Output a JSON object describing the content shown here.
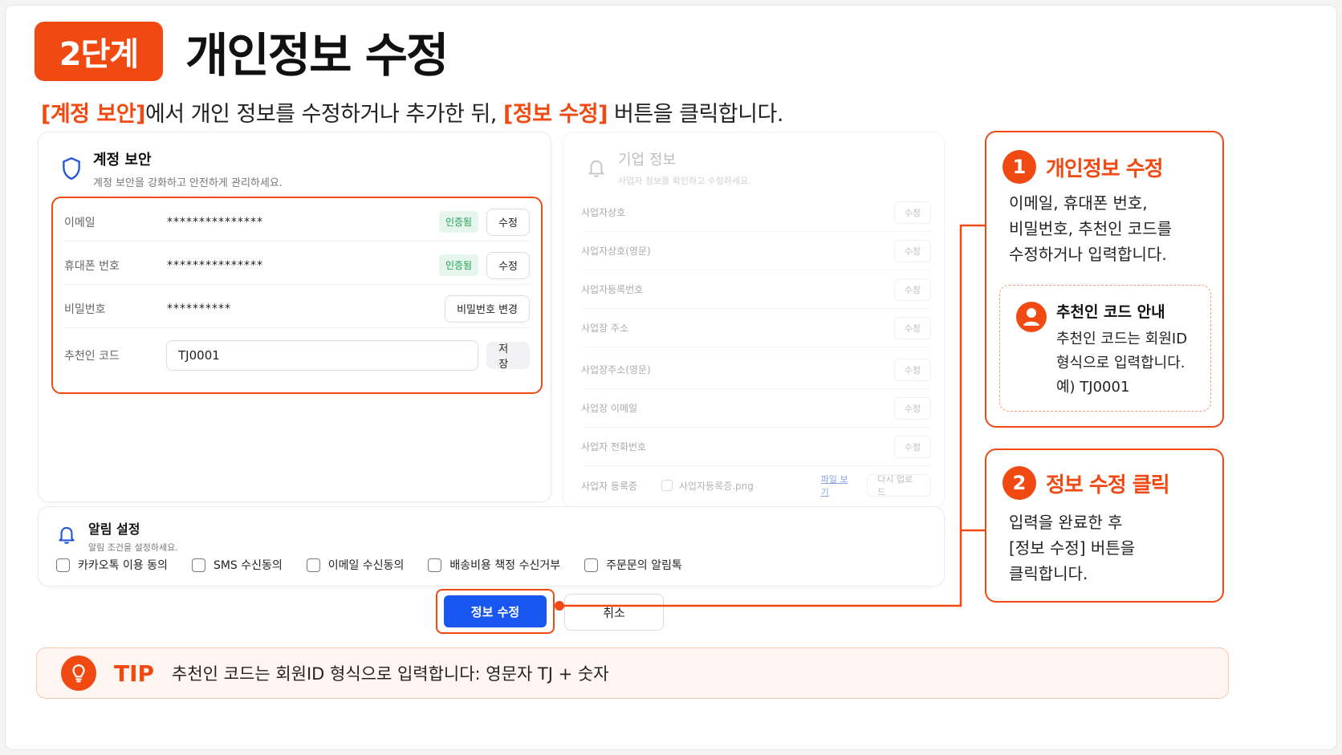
{
  "header": {
    "step_badge": "2단계",
    "title": "개인정보 수정",
    "subtitle": {
      "part1": "[계정 보안]",
      "part2": "에서 개인 정보를 수정하거나 추가한 뒤, ",
      "part3": "[정보 수정]",
      "part4": " 버튼을 클릭합니다."
    }
  },
  "security_card": {
    "title": "계정 보안",
    "desc": "계정 보안을 강화하고 안전하게 관리하세요.",
    "rows": [
      {
        "label": "이메일",
        "value": "***************",
        "badge": "인증됨",
        "button": "수정"
      },
      {
        "label": "휴대폰 번호",
        "value": "***************",
        "badge": "인증됨",
        "button": "수정"
      },
      {
        "label": "비밀번호",
        "value": "**********",
        "button": "비밀번호 변경"
      },
      {
        "label": "추천인 코드",
        "value": "TJ0001",
        "button": "저장"
      }
    ]
  },
  "business_card": {
    "title": "기업 정보",
    "desc": "사업자 정보를 확인하고 수정하세요.",
    "rows": [
      {
        "label": "사업자상호",
        "button": "수정"
      },
      {
        "label": "사업자상호(영문)",
        "button": "수정"
      },
      {
        "label": "사업자등록번호",
        "button": "수정"
      },
      {
        "label": "사업장 주소",
        "button": "수정"
      },
      {
        "label": "사업장주소(영문)",
        "button": "수정"
      },
      {
        "label": "사업장 이메일",
        "button": "수정"
      },
      {
        "label": "사업자 전화번호",
        "button": "수정"
      }
    ],
    "file_row": {
      "label": "사업자 등록증",
      "file_name": "사업자등록증.png",
      "view_link": "파일 보기",
      "reupload": "다시 업로드"
    }
  },
  "notify_card": {
    "title": "알림 설정",
    "desc": "알림 조건을 설정하세요.",
    "options": [
      "카카오톡 이용 동의",
      "SMS 수신동의",
      "이메일 수신동의",
      "배송비용 책정 수신거부",
      "주문문의 알림톡"
    ]
  },
  "actions": {
    "submit": "정보 수정",
    "cancel": "취소"
  },
  "annotation1": {
    "num": "1",
    "title": "개인정보 수정",
    "body": [
      "이메일, 휴대폰 번호,",
      "비밀번호, 추천인 코드를",
      "수정하거나 입력합니다."
    ],
    "note": {
      "title": "추천인 코드 안내",
      "body": [
        "추천인 코드는 회원ID",
        "형식으로 입력합니다.",
        "예) TJ0001"
      ]
    }
  },
  "annotation2": {
    "num": "2",
    "title": "정보 수정 클릭",
    "body": [
      "입력을 완료한 후",
      "[정보 수정] 버튼을",
      "클릭합니다."
    ]
  },
  "tip": {
    "label": "TIP",
    "text": "추천인 코드는 회원ID 형식으로 입력합니다:  영문자 TJ + 숫자"
  },
  "colors": {
    "accent": "#f04a12",
    "primary_button": "#1a56f0",
    "verified": "#1a9e52"
  }
}
